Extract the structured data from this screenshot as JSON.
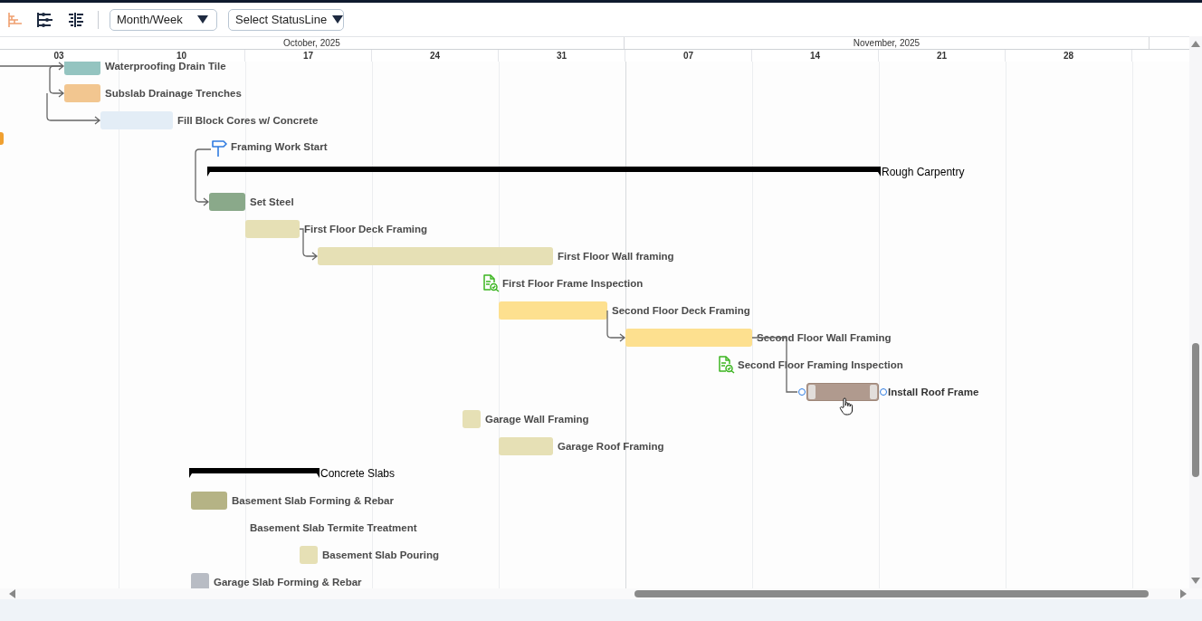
{
  "toolbar": {
    "dropdowns": [
      {
        "label": "Month/Week"
      },
      {
        "label": "Select StatusLine"
      }
    ]
  },
  "timeline": {
    "months": [
      "October, 2025",
      "November, 2025"
    ],
    "weeks": [
      "03",
      "10",
      "17",
      "24",
      "31",
      "07",
      "14",
      "21",
      "28"
    ]
  },
  "tasks": [
    {
      "label": "Waterproofing Drain Tile",
      "kind": "task",
      "color": "#94c4c0",
      "selected": false
    },
    {
      "label": "Subslab Drainage Trenches",
      "kind": "task",
      "color": "#f2c690",
      "selected": false
    },
    {
      "label": "Fill Block Cores w/ Concrete",
      "kind": "task",
      "color": "#e3edf6",
      "selected": false
    },
    {
      "label": "Framing Work Start",
      "kind": "milestone",
      "selected": false
    },
    {
      "label": "Rough Carpentry",
      "kind": "summary",
      "selected": false
    },
    {
      "label": "Set Steel",
      "kind": "task",
      "color": "#8aa98a",
      "selected": false
    },
    {
      "label": "First Floor Deck Framing",
      "kind": "task",
      "color": "#e6e0b5",
      "selected": false
    },
    {
      "label": "First Floor Wall framing",
      "kind": "task",
      "color": "#e6e0b5",
      "selected": false
    },
    {
      "label": "First Floor Frame Inspection",
      "kind": "inspection",
      "selected": false
    },
    {
      "label": "Second Floor Deck Framing",
      "kind": "task",
      "color": "#fde08f",
      "selected": false
    },
    {
      "label": "Second Floor Wall Framing",
      "kind": "task",
      "color": "#fde08f",
      "selected": false
    },
    {
      "label": "Second Floor Framing Inspection",
      "kind": "inspection",
      "selected": false
    },
    {
      "label": "Install Roof Frame",
      "kind": "task",
      "color": "#b09a8e",
      "selected": true
    },
    {
      "label": "Garage Wall Framing",
      "kind": "task",
      "color": "#e6e0b5",
      "selected": false
    },
    {
      "label": "Garage Roof Framing",
      "kind": "task",
      "color": "#e6e0b5",
      "selected": false
    },
    {
      "label": "Concrete Slabs",
      "kind": "summary",
      "selected": false
    },
    {
      "label": "Basement Slab Forming & Rebar",
      "kind": "task",
      "color": "#b5b385",
      "selected": false
    },
    {
      "label": "Basement Slab Termite Treatment",
      "kind": "text",
      "selected": false
    },
    {
      "label": "Basement Slab Pouring",
      "kind": "task",
      "color": "#e6e0b5",
      "selected": false
    },
    {
      "label": "Garage Slab Forming & Rebar",
      "kind": "task",
      "color": "#b8bcc4",
      "selected": false
    }
  ]
}
